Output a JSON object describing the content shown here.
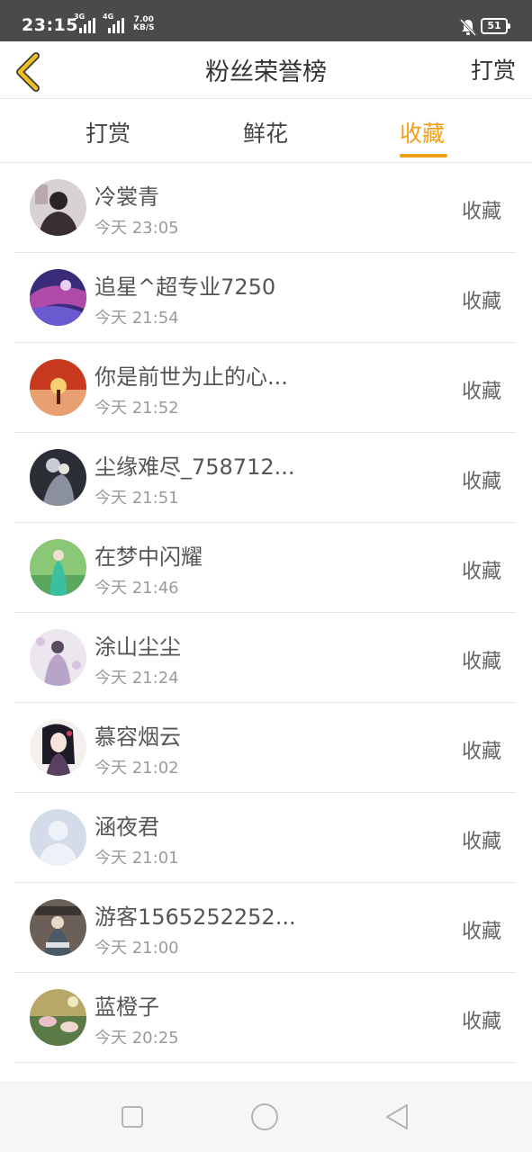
{
  "status_bar": {
    "time": "23:15",
    "network_1": "3G",
    "network_2": "4G",
    "speed_value": "7.00",
    "speed_unit": "KB/S",
    "battery": "51",
    "icons": [
      "signal-icon",
      "notifications-off-icon",
      "battery-icon"
    ]
  },
  "nav": {
    "title": "粉丝荣誉榜",
    "action_label": "打赏",
    "back_icon": "chevron-left-icon",
    "back_color": "#f0c020"
  },
  "tabs": [
    {
      "label": "打赏",
      "active": false
    },
    {
      "label": "鲜花",
      "active": false
    },
    {
      "label": "收藏",
      "active": true
    }
  ],
  "accent_color": "#f0a018",
  "fans": [
    {
      "name": "冷裳青",
      "time": "今天 23:05",
      "action": "收藏"
    },
    {
      "name": "追星^超专业7250",
      "time": "今天 21:54",
      "action": "收藏"
    },
    {
      "name": "你是前世为止的心...",
      "time": "今天 21:52",
      "action": "收藏"
    },
    {
      "name": "尘缘难尽_758712...",
      "time": "今天 21:51",
      "action": "收藏"
    },
    {
      "name": "在梦中闪耀",
      "time": "今天 21:46",
      "action": "收藏"
    },
    {
      "name": "涂山尘尘",
      "time": "今天 21:24",
      "action": "收藏"
    },
    {
      "name": "慕容烟云",
      "time": "今天 21:02",
      "action": "收藏"
    },
    {
      "name": "涵夜君",
      "time": "今天 21:01",
      "action": "收藏"
    },
    {
      "name": "游客1565252252...",
      "time": "今天 21:00",
      "action": "收藏"
    },
    {
      "name": "蓝橙子",
      "time": "今天 20:25",
      "action": "收藏"
    }
  ],
  "system_nav": {
    "icons": [
      "recent-apps-icon",
      "home-icon",
      "back-icon"
    ]
  }
}
